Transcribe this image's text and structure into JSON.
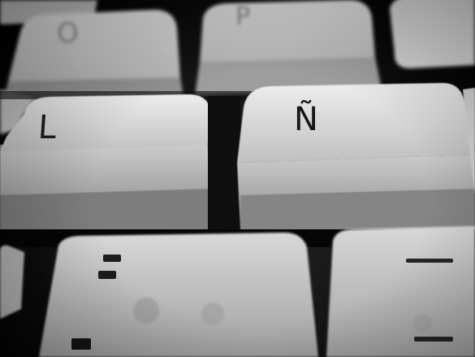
{
  "keys": {
    "o": "O",
    "p": "P",
    "l": "L",
    "enye": "Ñ"
  }
}
